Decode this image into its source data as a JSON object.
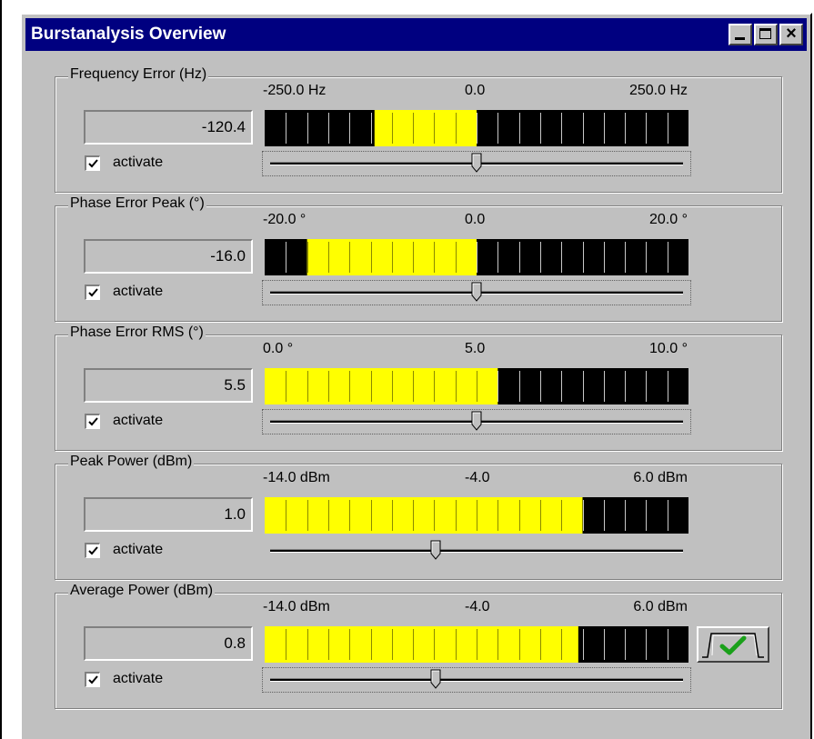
{
  "window": {
    "title": "Burstanalysis Overview",
    "buttons": [
      "minimize",
      "maximize",
      "close"
    ]
  },
  "common": {
    "activate_label": "activate"
  },
  "colors": {
    "bar_fill": "#ffff00",
    "bar_bg": "#000000",
    "title_bg": "#000080",
    "check_green": "#1aa01a"
  },
  "panels": [
    {
      "title": "Frequency Error (Hz)",
      "value": "-120.4",
      "scale": {
        "min": "-250.0 Hz",
        "mid": "0.0",
        "max": "250.0 Hz"
      },
      "range": [
        -250,
        250
      ],
      "reading": -120.4,
      "fill_from": 0,
      "activated": true,
      "slider_value": 0
    },
    {
      "title": "Phase Error Peak (°)",
      "value": "-16.0",
      "scale": {
        "min": "-20.0 °",
        "mid": "0.0",
        "max": "20.0 °"
      },
      "range": [
        -20,
        20
      ],
      "reading": -16.0,
      "fill_from": 0,
      "activated": true,
      "slider_value": 0
    },
    {
      "title": "Phase Error RMS (°)",
      "value": "5.5",
      "scale": {
        "min": "0.0 °",
        "mid": "5.0",
        "max": "10.0 °"
      },
      "range": [
        0,
        10
      ],
      "reading": 5.5,
      "fill_from": 0,
      "activated": true,
      "slider_value": 5
    },
    {
      "title": "Peak Power (dBm)",
      "value": "1.0",
      "scale": {
        "min": "-14.0 dBm",
        "mid": "-4.0",
        "max": "6.0 dBm"
      },
      "range": [
        -14,
        6
      ],
      "reading": 1.0,
      "fill_from": -14,
      "activated": true,
      "slider_value": -6
    },
    {
      "title": "Average Power (dBm)",
      "value": "0.8",
      "scale": {
        "min": "-14.0 dBm",
        "mid": "-4.0",
        "max": "6.0 dBm"
      },
      "range": [
        -14,
        6
      ],
      "reading": 0.8,
      "fill_from": -14,
      "activated": true,
      "slider_value": -6,
      "status_icon": "pass-check-icon"
    }
  ]
}
